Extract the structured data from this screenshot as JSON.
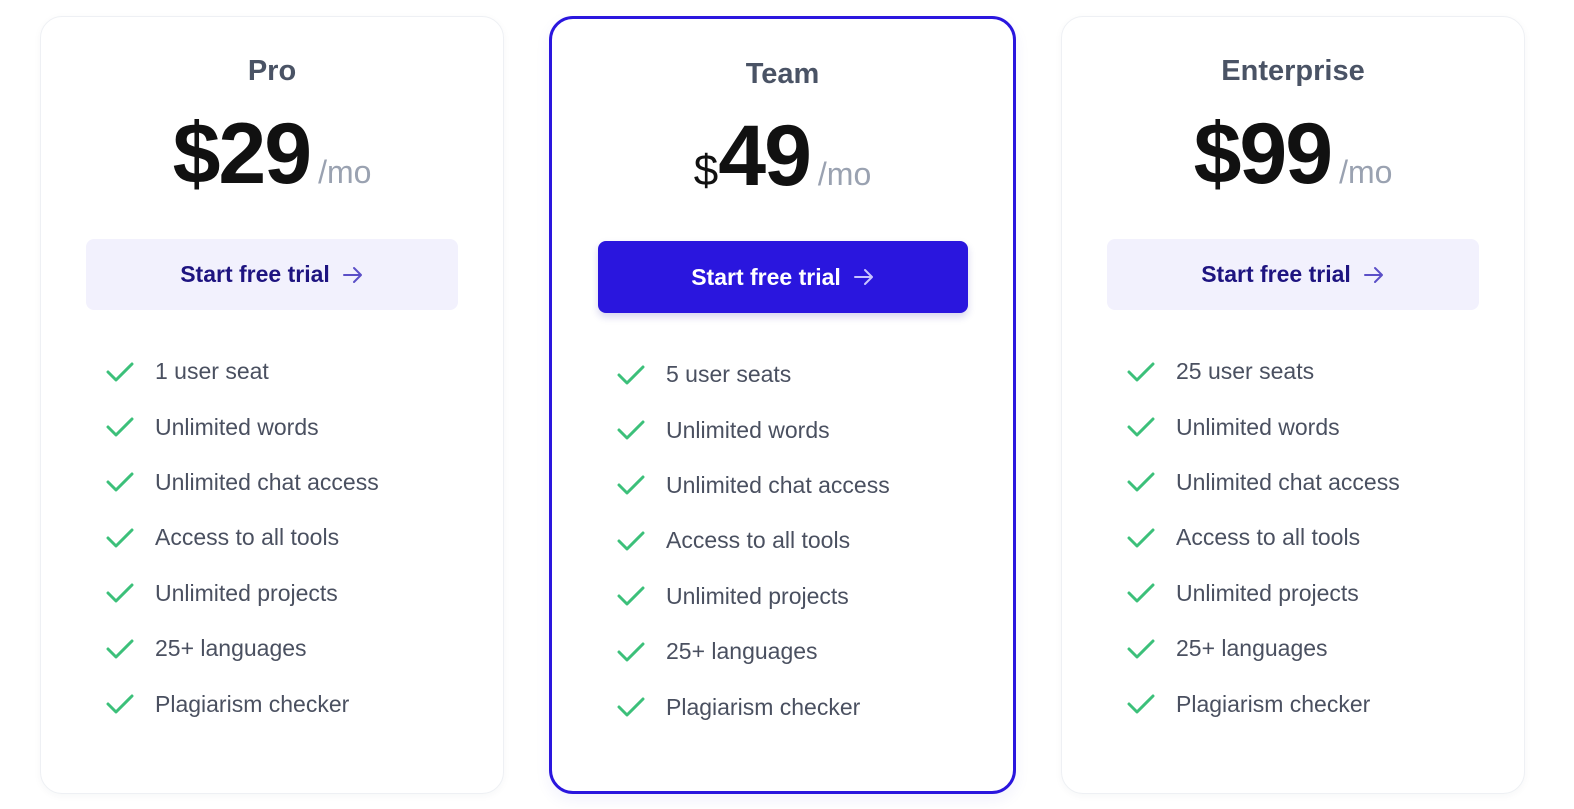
{
  "colors": {
    "accent": "#2a16de",
    "check": "#3cc07a",
    "light_button_bg": "#f2f1fd",
    "light_button_text": "#1e1480"
  },
  "plans": [
    {
      "name": "Pro",
      "currency": "$",
      "amount": "29",
      "period": "/mo",
      "cta_label": "Start free trial",
      "cta_icon": "arrow-right-icon",
      "featured": false,
      "features": [
        "1 user seat",
        "Unlimited words",
        "Unlimited chat access",
        "Access to all tools",
        "Unlimited projects",
        "25+ languages",
        "Plagiarism checker"
      ]
    },
    {
      "name": "Team",
      "currency": "$",
      "amount": "49",
      "period": "/mo",
      "cta_label": "Start free trial",
      "cta_icon": "arrow-right-icon",
      "featured": true,
      "features": [
        "5 user seats",
        "Unlimited words",
        "Unlimited chat access",
        "Access to all tools",
        "Unlimited projects",
        "25+ languages",
        "Plagiarism checker"
      ]
    },
    {
      "name": "Enterprise",
      "currency": "$",
      "amount": "99",
      "period": "/mo",
      "cta_label": "Start free trial",
      "cta_icon": "arrow-right-icon",
      "featured": false,
      "features": [
        "25 user seats",
        "Unlimited words",
        "Unlimited chat access",
        "Access to all tools",
        "Unlimited projects",
        "25+ languages",
        "Plagiarism checker"
      ]
    }
  ]
}
